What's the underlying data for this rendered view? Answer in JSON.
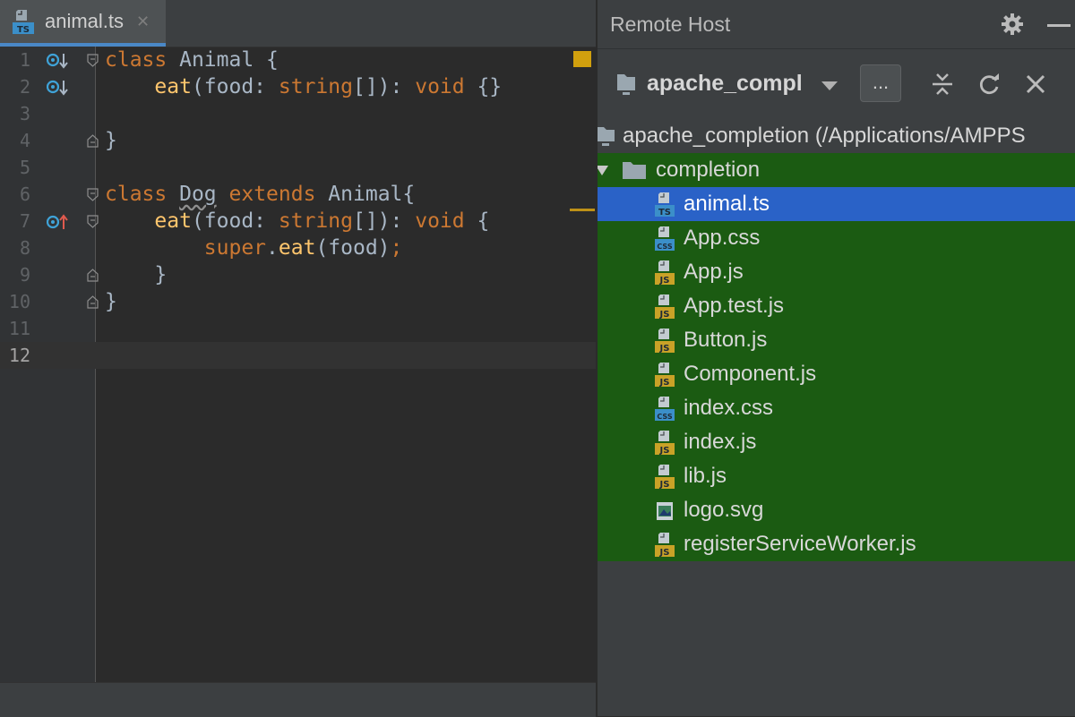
{
  "editor": {
    "tab": {
      "label": "animal.ts",
      "icon": "typescript-file-icon",
      "close_glyph": "✕"
    },
    "lines": [
      {
        "n": "1"
      },
      {
        "n": "2"
      },
      {
        "n": "3"
      },
      {
        "n": "4"
      },
      {
        "n": "5"
      },
      {
        "n": "6"
      },
      {
        "n": "7"
      },
      {
        "n": "8"
      },
      {
        "n": "9"
      },
      {
        "n": "10"
      },
      {
        "n": "11"
      },
      {
        "n": "12"
      }
    ],
    "code": {
      "l1": {
        "kw": "class",
        "name": " Animal {"
      },
      "l2": {
        "indent": "    ",
        "fn": "eat",
        "p1": "(food: ",
        "type": "string",
        "p2": "[]): ",
        "kw": "void",
        "p3": " {}"
      },
      "l4": {
        "text": "}"
      },
      "l6": {
        "kw": "class",
        "sp": " ",
        "name": "Dog",
        "sp2": " ",
        "kw2": "extends",
        "rest": " Animal{"
      },
      "l7": {
        "indent": "    ",
        "fn": "eat",
        "p1": "(food: ",
        "type": "string",
        "p2": "[]): ",
        "kw": "void",
        "p3": " {"
      },
      "l8": {
        "indent": "        ",
        "kw": "super",
        "dot": ".",
        "fn": "eat",
        "rest": "(food)",
        "semi": ";"
      },
      "l9": {
        "text": "    }"
      },
      "l10": {
        "text": "}"
      }
    }
  },
  "remote_host": {
    "title": "Remote Host",
    "server_name": "apache_compl",
    "browse_button": "...",
    "root": "apache_completion (/Applications/AMPPS",
    "folder": "completion",
    "files": [
      {
        "name": "animal.ts",
        "type": "TS",
        "selected": true
      },
      {
        "name": "App.css",
        "type": "CSS"
      },
      {
        "name": "App.js",
        "type": "JS"
      },
      {
        "name": "App.test.js",
        "type": "JS"
      },
      {
        "name": "Button.js",
        "type": "JS"
      },
      {
        "name": "Component.js",
        "type": "JS"
      },
      {
        "name": "index.css",
        "type": "CSS"
      },
      {
        "name": "index.js",
        "type": "JS"
      },
      {
        "name": "lib.js",
        "type": "JS"
      },
      {
        "name": "logo.svg",
        "type": "IMG"
      },
      {
        "name": "registerServiceWorker.js",
        "type": "JS"
      }
    ],
    "icons": [
      "gear-icon",
      "minimize-icon",
      "server-icon",
      "collapse-all-icon",
      "refresh-icon",
      "close-icon",
      "folder-icon"
    ]
  },
  "colors": {
    "keyword": "#cc7832",
    "function": "#ffc66d",
    "plain": "#a9b7c6",
    "selection": "#2a62c7",
    "highlight_green": "#1b5b12",
    "ts_badge": "#3b8fc9",
    "js_badge": "#c9a227",
    "css_badge": "#3b8fc9"
  }
}
